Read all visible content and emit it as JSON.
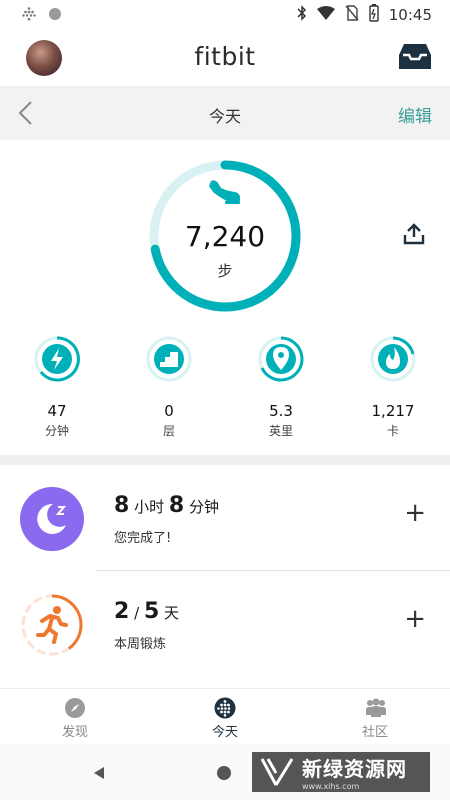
{
  "status_bar": {
    "time": "10:45",
    "icons": [
      "fitbit-dots-icon",
      "circle-icon",
      "bluetooth-icon",
      "wifi-icon",
      "no-sim-icon",
      "battery-icon"
    ]
  },
  "app_bar": {
    "title": "fitbit",
    "avatar": "avatar",
    "inbox_icon": "inbox-icon"
  },
  "date_bar": {
    "title": "今天",
    "edit_label": "编辑",
    "back_icon": "chevron-left-icon"
  },
  "steps": {
    "value": "7,240",
    "unit": "步",
    "progress": 0.72,
    "icon": "shoe-icon",
    "share_icon": "share-icon"
  },
  "stats": [
    {
      "value": "47",
      "label": "分钟",
      "icon": "lightning-icon"
    },
    {
      "value": "0",
      "label": "层",
      "icon": "stairs-icon"
    },
    {
      "value": "5.3",
      "label": "英里",
      "icon": "location-pin-icon"
    },
    {
      "value": "1,217",
      "label": "卡",
      "icon": "flame-icon"
    }
  ],
  "sleep_card": {
    "hours": "8",
    "hours_unit": "小时",
    "minutes": "8",
    "minutes_unit": "分钟",
    "subtitle": "您完成了!",
    "icon": "moon-icon",
    "plus": "+"
  },
  "exercise_card": {
    "done": "2",
    "slash": "/",
    "goal": "5",
    "unit": "天",
    "subtitle": "本周锻炼",
    "progress": 0.4,
    "icon": "running-person-icon",
    "plus": "+"
  },
  "bottom_nav": [
    {
      "label": "发现",
      "icon": "compass-icon",
      "active": false
    },
    {
      "label": "今天",
      "icon": "fitbit-dots-icon",
      "active": true
    },
    {
      "label": "社区",
      "icon": "community-icon",
      "active": false
    }
  ],
  "watermark": {
    "text": "新绿资源网",
    "sub": "www.xlhs.com"
  },
  "colors": {
    "teal": "#00b0b9",
    "teal_light": "#d8f1f2",
    "purple": "#8a6bf0",
    "orange": "#f0772e",
    "edit_text": "#3a9e98",
    "datebar_bg": "#f2f2f2"
  }
}
